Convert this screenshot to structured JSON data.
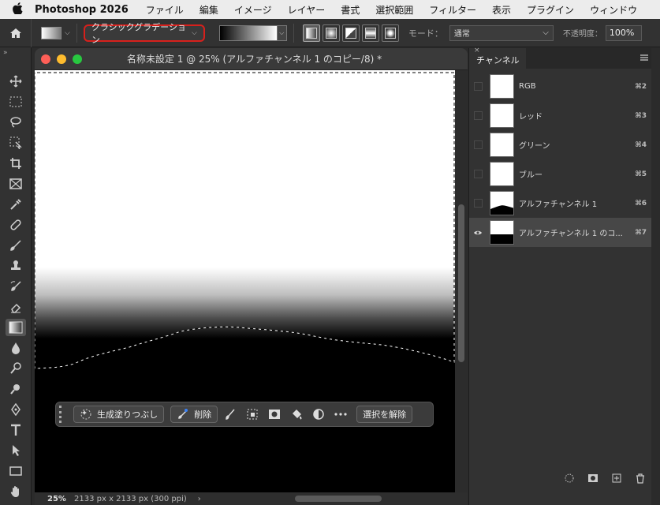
{
  "menubar": {
    "app_name": "Photoshop 2026",
    "items": [
      "ファイル",
      "編集",
      "イメージ",
      "レイヤー",
      "書式",
      "選択範囲",
      "フィルター",
      "表示",
      "プラグイン",
      "ウィンドウ"
    ]
  },
  "options": {
    "gradient_type": "クラシックグラデーション",
    "mode_label": "モード：",
    "mode_value": "通常",
    "opacity_label": "不透明度：",
    "opacity_value": "100%"
  },
  "document": {
    "title": "名称未設定 1 @ 25% (アルファチャンネル 1 のコピー/8) *",
    "zoom": "25%",
    "size_info": "2133 px x 2133 px (300 ppi)"
  },
  "taskbar": {
    "generative_fill": "生成塗りつぶし",
    "remove": "削除",
    "deselect": "選択を解除"
  },
  "channels_panel": {
    "tab": "チャンネル",
    "channels": [
      {
        "name": "RGB",
        "shortcut": "⌘2",
        "visible": false,
        "selected": false
      },
      {
        "name": "レッド",
        "shortcut": "⌘3",
        "visible": false,
        "selected": false
      },
      {
        "name": "グリーン",
        "shortcut": "⌘4",
        "visible": false,
        "selected": false
      },
      {
        "name": "ブルー",
        "shortcut": "⌘5",
        "visible": false,
        "selected": false
      },
      {
        "name": "アルファチャンネル 1",
        "shortcut": "⌘6",
        "visible": false,
        "selected": false
      },
      {
        "name": "アルファチャンネル 1 のコ...",
        "shortcut": "⌘7",
        "visible": true,
        "selected": true
      }
    ]
  },
  "colors": {
    "highlight_border": "#d7201c",
    "close": "#fe5f57",
    "minimize": "#febc2e",
    "zoom": "#28c840"
  }
}
